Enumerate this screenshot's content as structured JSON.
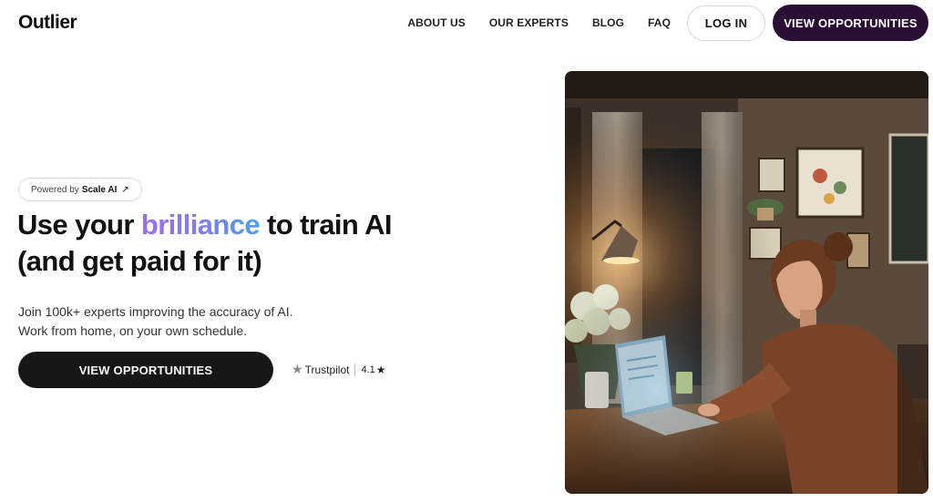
{
  "header": {
    "logo": "Outlier",
    "nav": [
      "ABOUT US",
      "OUR EXPERTS",
      "BLOG",
      "FAQ"
    ],
    "login_label": "LOG IN",
    "cta_label": "VIEW OPPORTUNITIES"
  },
  "hero": {
    "powered_prefix": "Powered by",
    "powered_brand": "Scale AI",
    "headline_part1": "Use your ",
    "headline_highlight": "brilliance",
    "headline_part2": " to train AI (and get paid for it)",
    "sub_line1": "Join 100k+ experts improving the accuracy of AI.",
    "sub_line2": "Work from home, on your own schedule.",
    "cta_label": "VIEW OPPORTUNITIES",
    "trustpilot_label": "Trustpilot",
    "rating": "4.1"
  },
  "icons": {
    "external_arrow": "arrow-up-right-icon",
    "trustpilot_star": "star-icon",
    "rating_star": "star-icon"
  },
  "colors": {
    "primary_dark": "#2a0f35",
    "cta_dark": "#171717",
    "gradient_start": "#9d6bf0",
    "gradient_end": "#4ba0ee"
  }
}
